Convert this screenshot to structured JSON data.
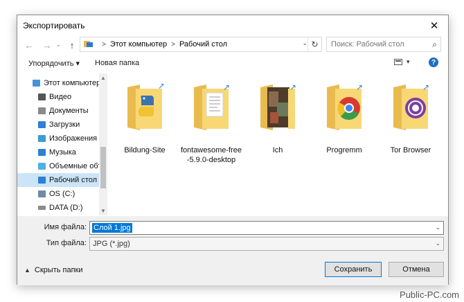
{
  "window": {
    "title": "Экспортировать",
    "close_label": "✕"
  },
  "address": {
    "back_icon": "arrow-left-icon",
    "forward_icon": "arrow-right-icon",
    "up_icon": "arrow-up-icon",
    "breadcrumbs": [
      "Этот компьютер",
      "Рабочий стол"
    ],
    "search_placeholder": "Поиск: Рабочий стол"
  },
  "toolbar": {
    "organize_label": "Упорядочить ▾",
    "new_folder_label": "Новая папка",
    "help_label": "?"
  },
  "sidebar": {
    "items": [
      {
        "label": "Этот компьютер",
        "icon": "computer-icon",
        "color": "#4a90d9"
      },
      {
        "label": "Видео",
        "icon": "video-folder-icon",
        "color": "#555555"
      },
      {
        "label": "Документы",
        "icon": "documents-folder-icon",
        "color": "#8a8a8a"
      },
      {
        "label": "Загрузки",
        "icon": "downloads-folder-icon",
        "color": "#2e7fd6"
      },
      {
        "label": "Изображения",
        "icon": "pictures-folder-icon",
        "color": "#3a9bd6"
      },
      {
        "label": "Музыка",
        "icon": "music-folder-icon",
        "color": "#2e7fd6"
      },
      {
        "label": "Объемные объ",
        "icon": "3d-objects-folder-icon",
        "color": "#4fb0e8"
      },
      {
        "label": "Рабочий стол",
        "icon": "desktop-folder-icon",
        "color": "#2e7fd6",
        "selected": true
      },
      {
        "label": "OS (C:)",
        "icon": "windows-drive-icon",
        "color": "#6e8aa6"
      },
      {
        "label": "DATA (D:)",
        "icon": "drive-icon",
        "color": "#8a8a8a"
      }
    ]
  },
  "files": [
    {
      "label": "Bildung-Site",
      "icon": "python-folder-icon",
      "accent": "#3a74b0"
    },
    {
      "label": "fontawesome-free-5.9.0-desktop",
      "icon": "document-folder-icon",
      "accent": "#ffffff"
    },
    {
      "label": "Ich",
      "icon": "photo-folder-icon",
      "accent": "#4d3b2c"
    },
    {
      "label": "Progremm",
      "icon": "chrome-folder-icon",
      "accent": "#d93a2f"
    },
    {
      "label": "Tor Browser",
      "icon": "tor-folder-icon",
      "accent": "#7d3fa0"
    }
  ],
  "form": {
    "filename_label": "Имя файла:",
    "filename_value": "Слой 1.jpg",
    "filetype_label": "Тип файла:",
    "filetype_value": "JPG (*.jpg)"
  },
  "footer": {
    "hide_folders_label": "Скрыть папки",
    "save_label": "Сохранить",
    "cancel_label": "Отмена"
  },
  "watermark": "Public-PC.com",
  "colors": {
    "accent": "#0078d7",
    "selection": "#cce4f7",
    "folder": "#f8d775"
  }
}
